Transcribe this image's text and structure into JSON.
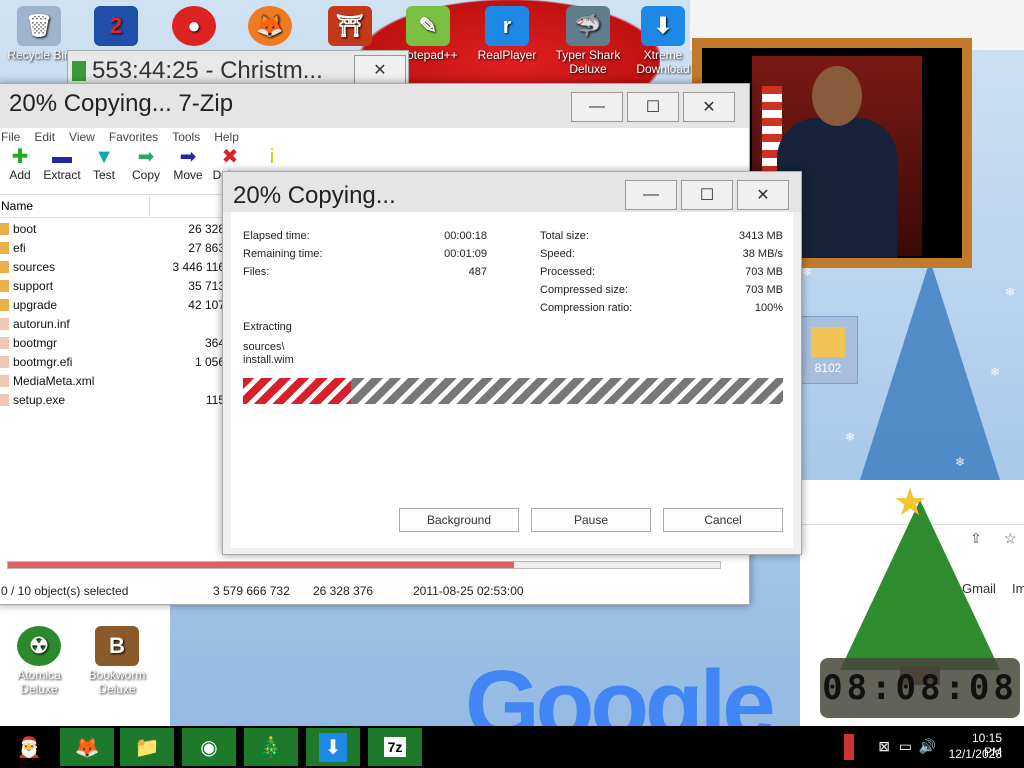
{
  "desktop": {
    "icons_top": [
      {
        "id": "recycle",
        "label": "Recycle Bin"
      },
      {
        "id": "q2",
        "label": ""
      },
      {
        "id": "zuma",
        "label": ""
      },
      {
        "id": "firefox",
        "label": ""
      },
      {
        "id": "shrine",
        "label": ""
      },
      {
        "id": "notepad",
        "label": "Notepad++"
      },
      {
        "id": "realplayer",
        "label": "RealPlayer"
      },
      {
        "id": "typershark",
        "label": "Typer Shark Deluxe"
      },
      {
        "id": "xtreme",
        "label": "Xtreme Download"
      }
    ],
    "icons_bottom": [
      {
        "id": "atomica",
        "label": "Atomica Deluxe"
      },
      {
        "id": "bookworm",
        "label": "Bookworm Deluxe"
      }
    ],
    "folder_8102": "8102",
    "browser": {
      "gmail": "Gmail",
      "images": "Im",
      "google_logo": "Google"
    },
    "clock_gadget": "08:08:08"
  },
  "timer_window": {
    "title": "553:44:25 - Christm..."
  },
  "zip_window": {
    "title": "20% Copying... 7-Zip",
    "menu": [
      "File",
      "Edit",
      "View",
      "Favorites",
      "Tools",
      "Help"
    ],
    "toolbar": [
      "Add",
      "Extract",
      "Test",
      "Copy",
      "Move",
      "Delete",
      "Info"
    ],
    "column_name": "Name",
    "files": [
      {
        "name": "boot",
        "size": "26 328",
        "type": "folder"
      },
      {
        "name": "efi",
        "size": "27 863",
        "type": "folder"
      },
      {
        "name": "sources",
        "size": "3 446 116",
        "type": "folder"
      },
      {
        "name": "support",
        "size": "35 713",
        "type": "folder"
      },
      {
        "name": "upgrade",
        "size": "42 107",
        "type": "folder"
      },
      {
        "name": "autorun.inf",
        "size": "",
        "type": "file"
      },
      {
        "name": "bootmgr",
        "size": "364",
        "type": "file"
      },
      {
        "name": "bootmgr.efi",
        "size": "1 056",
        "type": "file"
      },
      {
        "name": "MediaMeta.xml",
        "size": "",
        "type": "file"
      },
      {
        "name": "setup.exe",
        "size": "115",
        "type": "file"
      }
    ],
    "progress_fraction": 0.71,
    "status": {
      "selected": "0 / 10 object(s) selected",
      "size": "3 579 666 732",
      "packed": "26 328 376",
      "date": "2011-08-25 02:53:00"
    }
  },
  "copy_dialog": {
    "title": "20% Copying...",
    "left": [
      {
        "label": "Elapsed time:",
        "value": "00:00:18"
      },
      {
        "label": "Remaining time:",
        "value": "00:01:09"
      },
      {
        "label": "Files:",
        "value": "487"
      }
    ],
    "right": [
      {
        "label": "Total size:",
        "value": "3413 MB"
      },
      {
        "label": "Speed:",
        "value": "38 MB/s"
      },
      {
        "label": "Processed:",
        "value": "703 MB"
      },
      {
        "label": "Compressed size:",
        "value": "703 MB"
      },
      {
        "label": "Compression ratio:",
        "value": "100%"
      }
    ],
    "action": "Extracting",
    "path1": "sources\\",
    "path2": "install.wim",
    "progress_fraction": 0.2,
    "buttons": {
      "background": "Background",
      "pause": "Pause",
      "cancel": "Cancel"
    }
  },
  "taskbar": {
    "time": "10:15 PM",
    "date": "12/1/2023"
  }
}
